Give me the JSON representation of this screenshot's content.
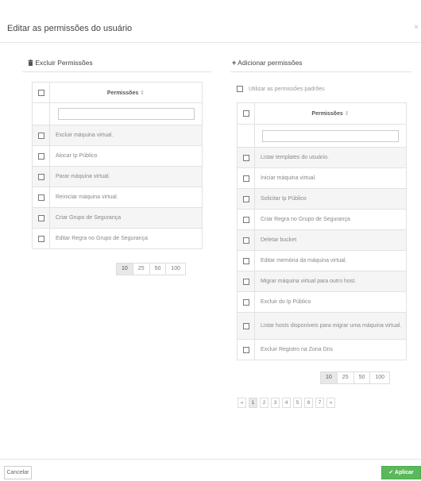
{
  "modal": {
    "title": "Editar as permissões do usuário",
    "close_icon": "close-icon"
  },
  "left": {
    "title_icon": "trash-icon",
    "title": "Excluir Permissões",
    "column_header": "Permissões",
    "sort_glyph": "⇕",
    "filter_placeholder": "",
    "rows": [
      "Excluir máquina virtual.",
      "Alocar Ip Público",
      "Parar máquina virtual.",
      "Reiniciar máquina virtual.",
      "Criar Grupo de Segurança",
      "Editar Regra no Grupo de Segurança"
    ],
    "page_sizes": [
      "10",
      "25",
      "50",
      "100"
    ],
    "active_page_size": "10"
  },
  "right": {
    "title_icon": "plus-icon",
    "title": "Adicionar permissões",
    "use_defaults_label": "Utilizar as permissões padrões",
    "column_header": "Permissões",
    "sort_glyph": "⇕",
    "filter_placeholder": "",
    "rows": [
      "Listar templates do usuário.",
      "Iniciar máquina virtual.",
      "Solicitar Ip Público",
      "Criar Regra no Grupo de Segurança",
      "Deletar bucket",
      "Editar memória da máquina virtual.",
      "Migrar máquina virtual para outro host.",
      "Excluir do Ip Público",
      "Listar hosts disponíveis para migrar uma máquina virtual.",
      "Excluir Registro na Zona Dns"
    ],
    "page_sizes": [
      "10",
      "25",
      "50",
      "100"
    ],
    "active_page_size": "10",
    "pages": [
      "«",
      "1",
      "2",
      "3",
      "4",
      "5",
      "6",
      "7",
      "»"
    ],
    "active_page": "1"
  },
  "footer": {
    "cancel_label": "Cancelar",
    "apply_icon": "check-icon",
    "apply_label": "Aplicar"
  },
  "colors": {
    "apply_bg": "#5cb85c",
    "row_alt": "#f5f5f5",
    "border": "#e2e2e2"
  }
}
